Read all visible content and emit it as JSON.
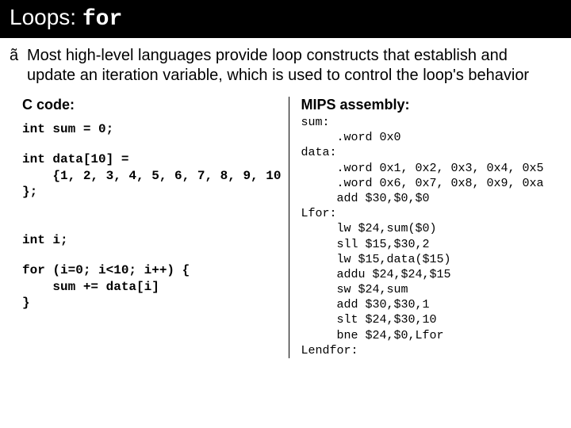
{
  "title": {
    "prefix": "Loops: ",
    "mono": "for"
  },
  "bullet": {
    "glyph": "ã",
    "text": "Most high-level languages provide loop constructs that establish and update an iteration variable, which is used to control the loop's behavior"
  },
  "left": {
    "heading": "C code:",
    "line1": "int sum = 0;",
    "block2_l1": "int data[10] =",
    "block2_l2": "    {1, 2, 3, 4, 5, 6, 7, 8, 9, 10",
    "block2_l3": "};",
    "line3": "int i;",
    "block4_l1": "for (i=0; i<10; i++) {",
    "block4_l2": "    sum += data[i]",
    "block4_l3": "}"
  },
  "right": {
    "heading": "MIPS assembly:",
    "asm_l1": "sum:",
    "asm_l2": "     .word 0x0",
    "asm_l3": "data:",
    "asm_l4": "     .word 0x1, 0x2, 0x3, 0x4, 0x5",
    "asm_l5": "     .word 0x6, 0x7, 0x8, 0x9, 0xa",
    "asm_l6": "",
    "asm_l7": "     add $30,$0,$0",
    "asm_l8": "Lfor:",
    "asm_l9": "     lw $24,sum($0)",
    "asm_l10": "     sll $15,$30,2",
    "asm_l11": "     lw $15,data($15)",
    "asm_l12": "     addu $24,$24,$15",
    "asm_l13": "     sw $24,sum",
    "asm_l14": "     add $30,$30,1",
    "asm_l15": "     slt $24,$30,10",
    "asm_l16": "     bne $24,$0,Lfor",
    "asm_l17": "Lendfor:"
  }
}
